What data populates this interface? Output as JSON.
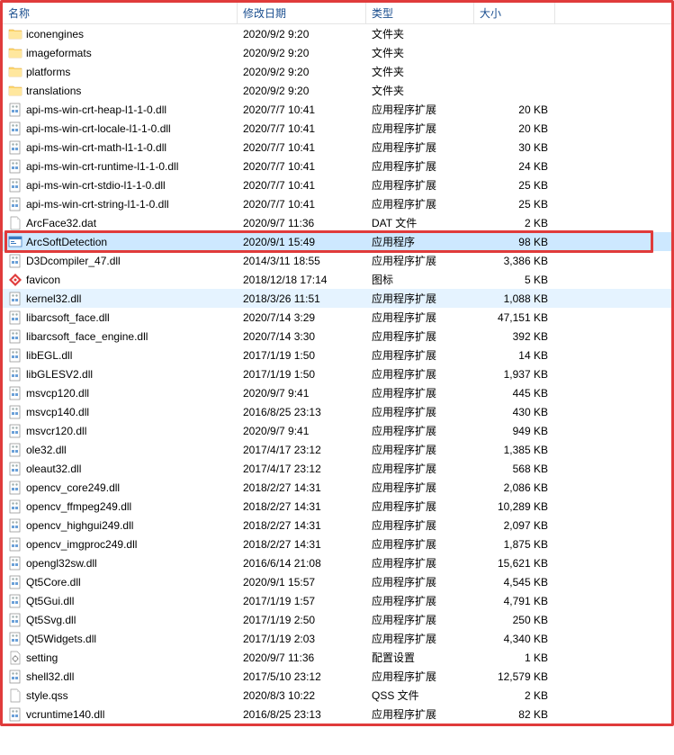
{
  "header": {
    "name": "名称",
    "date": "修改日期",
    "type": "类型",
    "size": "大小"
  },
  "files": [
    {
      "icon": "folder",
      "name": "iconengines",
      "date": "2020/9/2 9:20",
      "type": "文件夹",
      "size": ""
    },
    {
      "icon": "folder",
      "name": "imageformats",
      "date": "2020/9/2 9:20",
      "type": "文件夹",
      "size": ""
    },
    {
      "icon": "folder",
      "name": "platforms",
      "date": "2020/9/2 9:20",
      "type": "文件夹",
      "size": ""
    },
    {
      "icon": "folder",
      "name": "translations",
      "date": "2020/9/2 9:20",
      "type": "文件夹",
      "size": ""
    },
    {
      "icon": "dll",
      "name": "api-ms-win-crt-heap-l1-1-0.dll",
      "date": "2020/7/7 10:41",
      "type": "应用程序扩展",
      "size": "20 KB"
    },
    {
      "icon": "dll",
      "name": "api-ms-win-crt-locale-l1-1-0.dll",
      "date": "2020/7/7 10:41",
      "type": "应用程序扩展",
      "size": "20 KB"
    },
    {
      "icon": "dll",
      "name": "api-ms-win-crt-math-l1-1-0.dll",
      "date": "2020/7/7 10:41",
      "type": "应用程序扩展",
      "size": "30 KB"
    },
    {
      "icon": "dll",
      "name": "api-ms-win-crt-runtime-l1-1-0.dll",
      "date": "2020/7/7 10:41",
      "type": "应用程序扩展",
      "size": "24 KB"
    },
    {
      "icon": "dll",
      "name": "api-ms-win-crt-stdio-l1-1-0.dll",
      "date": "2020/7/7 10:41",
      "type": "应用程序扩展",
      "size": "25 KB"
    },
    {
      "icon": "dll",
      "name": "api-ms-win-crt-string-l1-1-0.dll",
      "date": "2020/7/7 10:41",
      "type": "应用程序扩展",
      "size": "25 KB"
    },
    {
      "icon": "dat",
      "name": "ArcFace32.dat",
      "date": "2020/9/7 11:36",
      "type": "DAT 文件",
      "size": "2 KB"
    },
    {
      "icon": "exe",
      "name": "ArcSoftDetection",
      "date": "2020/9/1 15:49",
      "type": "应用程序",
      "size": "98 KB",
      "selected": true,
      "highlight": true
    },
    {
      "icon": "dll",
      "name": "D3Dcompiler_47.dll",
      "date": "2014/3/11 18:55",
      "type": "应用程序扩展",
      "size": "3,386 KB"
    },
    {
      "icon": "favicon",
      "name": "favicon",
      "date": "2018/12/18 17:14",
      "type": "图标",
      "size": "5 KB"
    },
    {
      "icon": "dll",
      "name": "kernel32.dll",
      "date": "2018/3/26 11:51",
      "type": "应用程序扩展",
      "size": "1,088 KB",
      "hover": true
    },
    {
      "icon": "dll",
      "name": "libarcsoft_face.dll",
      "date": "2020/7/14 3:29",
      "type": "应用程序扩展",
      "size": "47,151 KB"
    },
    {
      "icon": "dll",
      "name": "libarcsoft_face_engine.dll",
      "date": "2020/7/14 3:30",
      "type": "应用程序扩展",
      "size": "392 KB"
    },
    {
      "icon": "dll",
      "name": "libEGL.dll",
      "date": "2017/1/19 1:50",
      "type": "应用程序扩展",
      "size": "14 KB"
    },
    {
      "icon": "dll",
      "name": "libGLESV2.dll",
      "date": "2017/1/19 1:50",
      "type": "应用程序扩展",
      "size": "1,937 KB"
    },
    {
      "icon": "dll",
      "name": "msvcp120.dll",
      "date": "2020/9/7 9:41",
      "type": "应用程序扩展",
      "size": "445 KB"
    },
    {
      "icon": "dll",
      "name": "msvcp140.dll",
      "date": "2016/8/25 23:13",
      "type": "应用程序扩展",
      "size": "430 KB"
    },
    {
      "icon": "dll",
      "name": "msvcr120.dll",
      "date": "2020/9/7 9:41",
      "type": "应用程序扩展",
      "size": "949 KB"
    },
    {
      "icon": "dll",
      "name": "ole32.dll",
      "date": "2017/4/17 23:12",
      "type": "应用程序扩展",
      "size": "1,385 KB"
    },
    {
      "icon": "dll",
      "name": "oleaut32.dll",
      "date": "2017/4/17 23:12",
      "type": "应用程序扩展",
      "size": "568 KB"
    },
    {
      "icon": "dll",
      "name": "opencv_core249.dll",
      "date": "2018/2/27 14:31",
      "type": "应用程序扩展",
      "size": "2,086 KB"
    },
    {
      "icon": "dll",
      "name": "opencv_ffmpeg249.dll",
      "date": "2018/2/27 14:31",
      "type": "应用程序扩展",
      "size": "10,289 KB"
    },
    {
      "icon": "dll",
      "name": "opencv_highgui249.dll",
      "date": "2018/2/27 14:31",
      "type": "应用程序扩展",
      "size": "2,097 KB"
    },
    {
      "icon": "dll",
      "name": "opencv_imgproc249.dll",
      "date": "2018/2/27 14:31",
      "type": "应用程序扩展",
      "size": "1,875 KB"
    },
    {
      "icon": "dll",
      "name": "opengl32sw.dll",
      "date": "2016/6/14 21:08",
      "type": "应用程序扩展",
      "size": "15,621 KB"
    },
    {
      "icon": "dll",
      "name": "Qt5Core.dll",
      "date": "2020/9/1 15:57",
      "type": "应用程序扩展",
      "size": "4,545 KB"
    },
    {
      "icon": "dll",
      "name": "Qt5Gui.dll",
      "date": "2017/1/19 1:57",
      "type": "应用程序扩展",
      "size": "4,791 KB"
    },
    {
      "icon": "dll",
      "name": "Qt5Svg.dll",
      "date": "2017/1/19 2:50",
      "type": "应用程序扩展",
      "size": "250 KB"
    },
    {
      "icon": "dll",
      "name": "Qt5Widgets.dll",
      "date": "2017/1/19 2:03",
      "type": "应用程序扩展",
      "size": "4,340 KB"
    },
    {
      "icon": "ini",
      "name": "setting",
      "date": "2020/9/7 11:36",
      "type": "配置设置",
      "size": "1 KB"
    },
    {
      "icon": "dll",
      "name": "shell32.dll",
      "date": "2017/5/10 23:12",
      "type": "应用程序扩展",
      "size": "12,579 KB"
    },
    {
      "icon": "file",
      "name": "style.qss",
      "date": "2020/8/3 10:22",
      "type": "QSS 文件",
      "size": "2 KB"
    },
    {
      "icon": "dll",
      "name": "vcruntime140.dll",
      "date": "2016/8/25 23:13",
      "type": "应用程序扩展",
      "size": "82 KB"
    }
  ]
}
